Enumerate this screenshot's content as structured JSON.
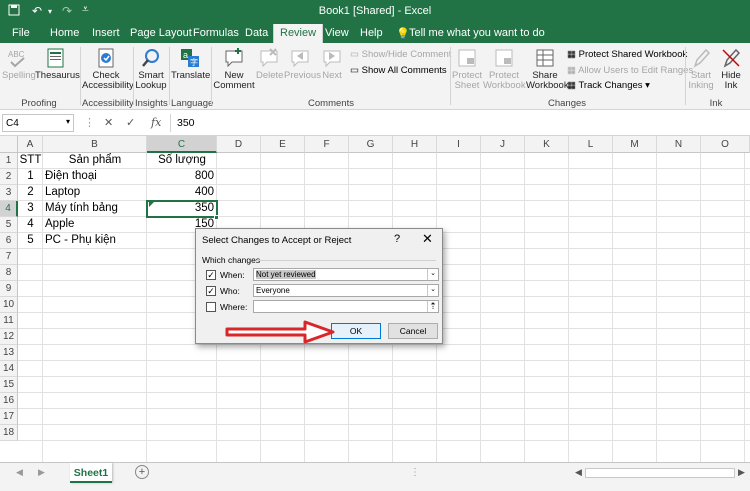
{
  "window": {
    "title": "Book1 [Shared] - Excel",
    "autosave_icon": "save-icon",
    "undo_icon": "undo-icon",
    "redo_icon": "redo-icon"
  },
  "tabs": [
    {
      "label": "File"
    },
    {
      "label": "Home"
    },
    {
      "label": "Insert"
    },
    {
      "label": "Page Layout"
    },
    {
      "label": "Formulas"
    },
    {
      "label": "Data"
    },
    {
      "label": "Review",
      "active": true
    },
    {
      "label": "View"
    },
    {
      "label": "Help"
    }
  ],
  "tell_me": "Tell me what you want to do",
  "ribbon": {
    "proofing": {
      "spelling": "Spelling",
      "thesaurus": "Thesaurus",
      "group": "Proofing"
    },
    "accessibility": {
      "check": "Check Accessibility",
      "group": "Accessibility"
    },
    "insights": {
      "smart_lookup": "Smart Lookup",
      "group": "Insights"
    },
    "language": {
      "translate": "Translate",
      "group": "Language"
    },
    "comments": {
      "new": "New Comment",
      "delete": "Delete",
      "previous": "Previous",
      "next": "Next",
      "show_hide": "Show/Hide Comment",
      "show_all": "Show All Comments",
      "group": "Comments"
    },
    "changes": {
      "protect_sheet": "Protect Sheet",
      "protect_workbook": "Protect Workbook",
      "share_workbook": "Share Workbook",
      "protect_shared": "Protect Shared Workbook",
      "allow_users": "Allow Users to Edit Ranges",
      "track_changes": "Track Changes",
      "group": "Changes"
    },
    "ink": {
      "start_inking": "Start Inking",
      "hide_ink": "Hide Ink",
      "group": "Ink"
    }
  },
  "formula_bar": {
    "name_box": "C4",
    "value": "350",
    "fx": "fx"
  },
  "columns": [
    "A",
    "B",
    "C",
    "D",
    "E",
    "F",
    "G",
    "H",
    "I",
    "J",
    "K",
    "L",
    "M",
    "N",
    "O"
  ],
  "rows": [
    "1",
    "2",
    "3",
    "4",
    "5",
    "6",
    "7",
    "8",
    "9",
    "10",
    "11",
    "12",
    "13",
    "14",
    "15",
    "16",
    "17",
    "18"
  ],
  "cells": {
    "A1": "STT",
    "B1": "Sản phẩm",
    "C1": "Số lượng",
    "A2": "1",
    "B2": "Điện thoại",
    "C2": "800",
    "A3": "2",
    "B3": "Laptop",
    "C3": "400",
    "A4": "3",
    "B4": "Máy tính bảng",
    "C4": "350",
    "A5": "4",
    "B5": "Apple",
    "C5": "150",
    "A6": "5",
    "B6": "PC - Phụ kiện"
  },
  "dialog": {
    "title": "Select Changes to Accept or Reject",
    "help": "?",
    "close": "✕",
    "section": "Which changes",
    "when_label": "When:",
    "when_value": "Not yet reviewed",
    "when_checked": true,
    "who_label": "Who:",
    "who_value": "Everyone",
    "who_checked": true,
    "where_label": "Where:",
    "where_value": "",
    "where_checked": false,
    "ok": "OK",
    "cancel": "Cancel"
  },
  "sheet_tabs": [
    {
      "label": "Sheet1",
      "active": true
    }
  ],
  "colors": {
    "accent": "#217346",
    "arrow": "#d9262b"
  }
}
